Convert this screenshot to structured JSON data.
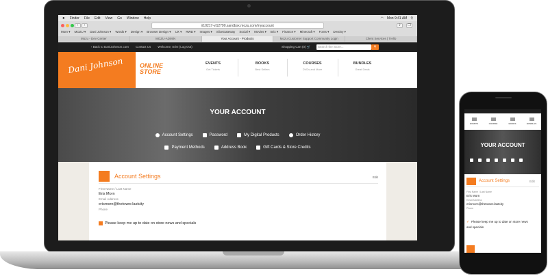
{
  "menubar": {
    "apple": "",
    "items": [
      "Finder",
      "File",
      "Edit",
      "View",
      "Go",
      "Window",
      "Help"
    ],
    "clock": "Mon 9:41 AM"
  },
  "browser": {
    "url": "ii10217-vi12790.sandbox.mozu.com/myaccount",
    "back": "‹",
    "forward": "›",
    "bookmarks": [
      "Mom ▾",
      "MOZU ▾",
      "Dani Johnson ▾",
      "Words ▾",
      "Design ▾",
      "Browser Design ▾",
      "UX ▾",
      "RWD ▾",
      "Images ▾",
      "SliceGateway",
      "Social ▾",
      "Movies ▾",
      "Brix ▾",
      "Finance ▾",
      "Minecraft ▾",
      "Fonts ▾",
      "Destiny ▾"
    ],
    "tabs": [
      "Mozu - Dev Center",
      "MOZU-ADMIN",
      "Your Account - Products",
      "Mozu Customer Support Community Login",
      "Client Services | Trello"
    ]
  },
  "site": {
    "topbar": {
      "back_link": "‹ Back to DaniJohnson.com",
      "contact": "Contact Us",
      "welcome": "Welcome, Eris! (Log Out)",
      "cart": "Shopping Cart (0)",
      "search_placeholder": "Search the Store...",
      "search_button": "⚲"
    },
    "logo": "Dani Johnson",
    "store_label": "ONLINE STORE",
    "nav": [
      {
        "title": "EVENTS",
        "sub": "Get Tickets"
      },
      {
        "title": "BOOKS",
        "sub": "Best Sellers"
      },
      {
        "title": "COURSES",
        "sub": "DVDs and More"
      },
      {
        "title": "BUNDLES",
        "sub": "Great Deals"
      }
    ],
    "hero": {
      "title": "YOUR ACCOUNT",
      "links_row1": [
        "Account Settings",
        "Password",
        "My Digital Products",
        "Order History"
      ],
      "links_row2": [
        "Payment Methods",
        "Address Book",
        "Gift Cards & Store Credits"
      ]
    },
    "account": {
      "title": "Account Settings",
      "edit": "Edit",
      "name_label": "First Name / Last Name",
      "name": "Eris Morn",
      "email_label": "Email Address",
      "email": "erismorn@thetower.lastcity",
      "phone_label": "Phone",
      "newsletter": "Please keep me up to date on store news and specials"
    }
  },
  "phone": {
    "nav": [
      "EVENTS",
      "COURSE",
      "BOOKS",
      "BUNDLES"
    ],
    "hero_title": "YOUR ACCOUNT",
    "card_title": "Account Settings",
    "edit": "Edit",
    "name_label": "First Name / Last Name",
    "name": "Eris Morn",
    "email_label": "Email Address",
    "email": "erismorn@thetower.lastcity",
    "phone_label": "Phone",
    "newsletter_1": "Please keep me up to date on store news",
    "newsletter_2": "and specials"
  },
  "colors": {
    "accent": "#f47c20",
    "dark": "#1f1f1f"
  }
}
